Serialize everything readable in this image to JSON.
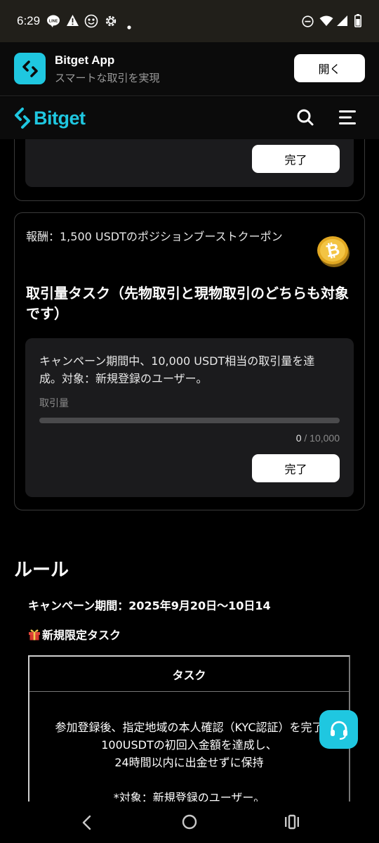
{
  "status_bar": {
    "time": "6:29",
    "line_badge": "LINE"
  },
  "app_banner": {
    "name": "Bitget App",
    "subtitle": "スマートな取引を実現",
    "open_label": "開く"
  },
  "nav": {
    "brand": "Bitget"
  },
  "card_1": {
    "button_label": "完了"
  },
  "task_card": {
    "reward": "報酬：1,500 USDTのポジションブーストクーポン",
    "title": "取引量タスク（先物取引と現物取引のどちらも対象です）",
    "description": "キャンペーン期間中、10,000 USDT相当の取引量を達成。対象：新規登録のユーザー。",
    "progress_label": "取引量",
    "progress_current": "0",
    "progress_total": " / 10,000",
    "progress_fraction": 0,
    "button_label": "完了"
  },
  "rules": {
    "title": "ルール",
    "period": "キャンペーン期間：2025年9月20日～10日14",
    "new_task": "新規限定タスク",
    "table": {
      "header": "タスク",
      "line1": "参加登録後、指定地域の本人確認（KYC認証）を完了",
      "line2": "100USDTの初回入金額を達成し、",
      "line3": "24時間以内に出金せずに保持",
      "line4": "*対象：新規登録のユーザー。"
    }
  },
  "colors": {
    "accent": "#1fc7e0",
    "background": "#000000",
    "card_inner": "#1b1b1d"
  }
}
